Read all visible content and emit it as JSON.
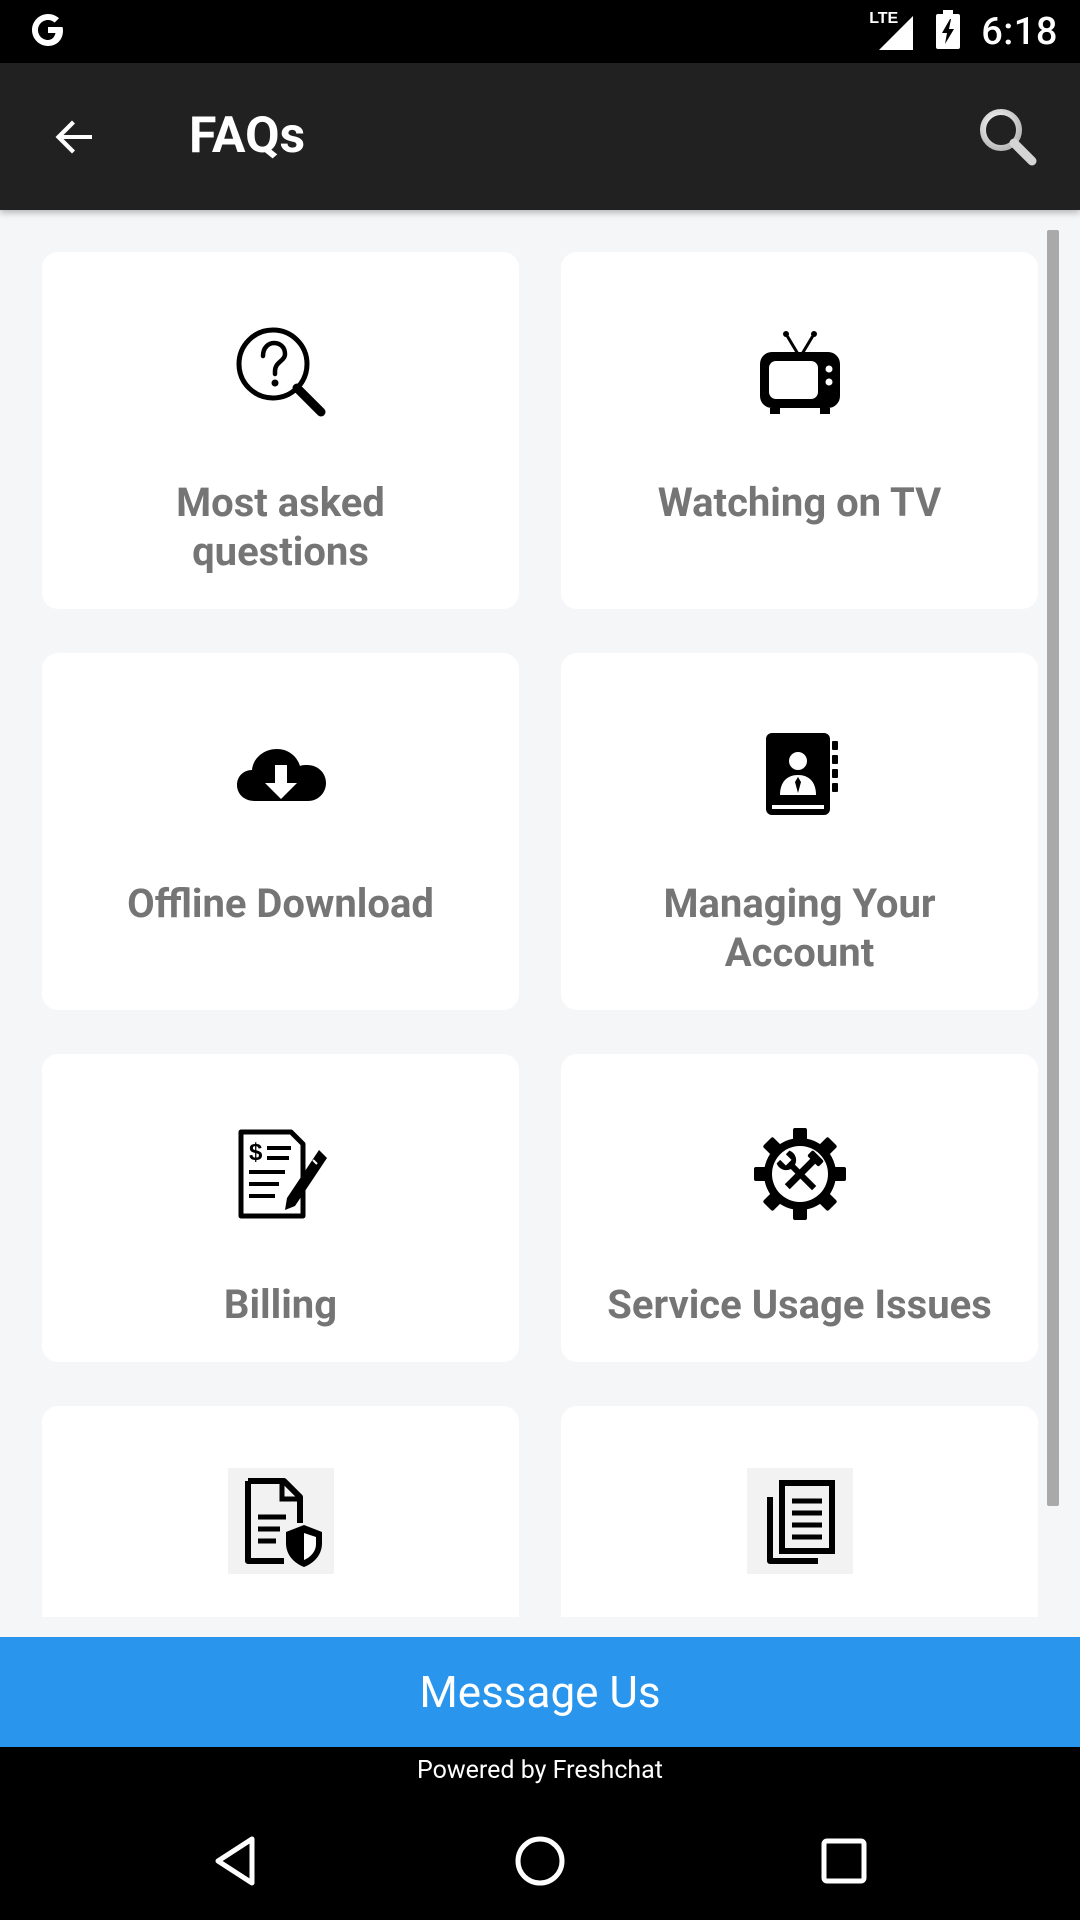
{
  "status_bar": {
    "carrier_logo": "G",
    "network": "LTE",
    "time": "6:18",
    "icons": [
      "google-icon",
      "lte-signal-icon",
      "battery-charging-icon"
    ]
  },
  "app_bar": {
    "title": "FAQs",
    "back_icon": "arrow-left-icon",
    "search_icon": "search-icon"
  },
  "categories": [
    {
      "label": "Most asked questions",
      "icon": "question-magnifier-icon"
    },
    {
      "label": "Watching on TV",
      "icon": "tv-icon"
    },
    {
      "label": "Offline Download",
      "icon": "cloud-download-icon"
    },
    {
      "label": "Managing Your Account",
      "icon": "contact-book-icon"
    },
    {
      "label": "Billing",
      "icon": "invoice-edit-icon"
    },
    {
      "label": "Service Usage Issues",
      "icon": "gear-tools-icon"
    },
    {
      "label": "",
      "icon": "document-shield-icon"
    },
    {
      "label": "",
      "icon": "documents-copy-icon"
    }
  ],
  "footer": {
    "message_button": "Message Us",
    "powered_by": "Powered by Freshchat"
  },
  "colors": {
    "app_bar": "#212121",
    "accent_button": "#2a95ec",
    "card_label": "#757575",
    "background": "#f5f6f8"
  },
  "nav_bar": {
    "icons": [
      "back-triangle-icon",
      "home-circle-icon",
      "recents-square-icon"
    ]
  }
}
